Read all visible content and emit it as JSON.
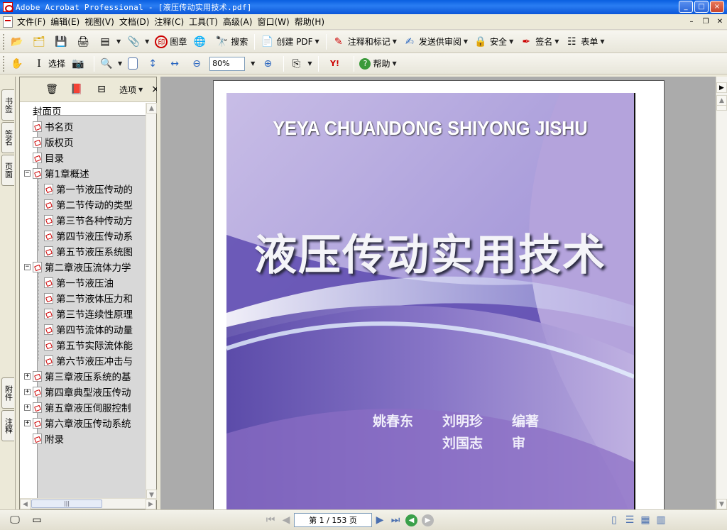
{
  "window": {
    "title": "Adobe Acrobat Professional - [液压传动实用技术.pdf]",
    "minimize": "_",
    "maximize": "□",
    "close": "×"
  },
  "menu": [
    "文件(F)",
    "编辑(E)",
    "视图(V)",
    "文档(D)",
    "注释(C)",
    "工具(T)",
    "高级(A)",
    "窗口(W)",
    "帮助(H)"
  ],
  "toolbar1": {
    "stamp": "图章",
    "search": "搜索",
    "create_pdf": "创建 PDF",
    "comment": "注释和标记",
    "send_review": "发送供审阅",
    "security": "安全",
    "sign": "签名",
    "forms": "表单"
  },
  "toolbar2": {
    "select": "选择",
    "zoom_value": "80%",
    "help": "帮助"
  },
  "navtabs": [
    "书签",
    "签名",
    "页面",
    "附件",
    "注释"
  ],
  "bookmarks_panel": {
    "options": "选项",
    "close": "×",
    "items": [
      {
        "label": "封面页",
        "level": 0,
        "toggle": "",
        "cover": true
      },
      {
        "label": "书名页",
        "level": 0,
        "toggle": ""
      },
      {
        "label": "版权页",
        "level": 0,
        "toggle": ""
      },
      {
        "label": "目录",
        "level": 0,
        "toggle": ""
      },
      {
        "label": "第1章概述",
        "level": 0,
        "toggle": "−"
      },
      {
        "label": "第一节液压传动的",
        "level": 1,
        "toggle": ""
      },
      {
        "label": "第二节传动的类型",
        "level": 1,
        "toggle": ""
      },
      {
        "label": "第三节各种传动方",
        "level": 1,
        "toggle": ""
      },
      {
        "label": "第四节液压传动系",
        "level": 1,
        "toggle": ""
      },
      {
        "label": "第五节液压系统图",
        "level": 1,
        "toggle": ""
      },
      {
        "label": "第二章液压流体力学",
        "level": 0,
        "toggle": "−"
      },
      {
        "label": "第一节液压油",
        "level": 1,
        "toggle": ""
      },
      {
        "label": "第二节液体压力和",
        "level": 1,
        "toggle": ""
      },
      {
        "label": "第三节连续性原理",
        "level": 1,
        "toggle": ""
      },
      {
        "label": "第四节流体的动量",
        "level": 1,
        "toggle": ""
      },
      {
        "label": "第五节实际流体能",
        "level": 1,
        "toggle": ""
      },
      {
        "label": "第六节液压冲击与",
        "level": 1,
        "toggle": ""
      },
      {
        "label": "第三章液压系统的基",
        "level": 0,
        "toggle": "+"
      },
      {
        "label": "第四章典型液压传动",
        "level": 0,
        "toggle": "+"
      },
      {
        "label": "第五章液压伺服控制",
        "level": 0,
        "toggle": "+"
      },
      {
        "label": "第六章液压传动系统",
        "level": 0,
        "toggle": "+"
      },
      {
        "label": "附录",
        "level": 0,
        "toggle": ""
      }
    ]
  },
  "document": {
    "title_en": "YEYA CHUANDONG SHIYONG JISHU",
    "title_cn": "液压传动实用技术",
    "author1": "姚春东",
    "author2": "刘明珍",
    "role1": "编著",
    "reviewer": "刘国志",
    "role2": "审"
  },
  "status": {
    "page_display": "第 1 / 153 页"
  },
  "colors": {
    "titlebar": "#0a5fe0",
    "cover_purple": "#6650b4",
    "doc_bg": "#ababab"
  }
}
